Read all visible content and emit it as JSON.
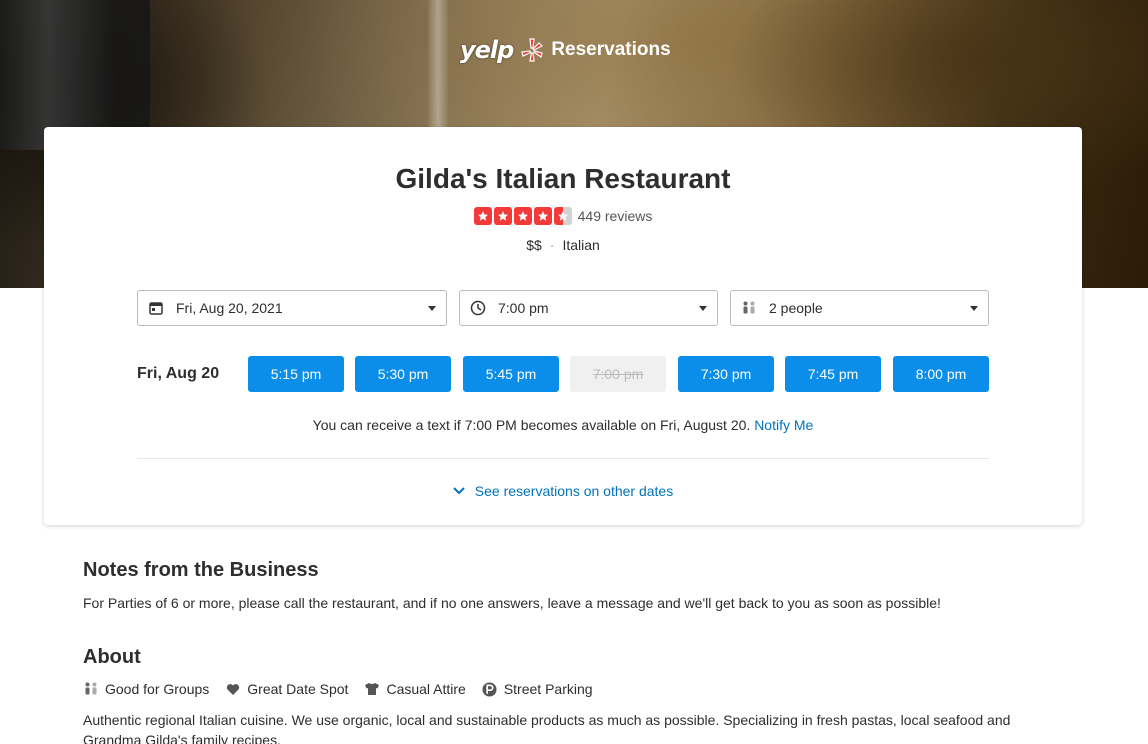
{
  "header": {
    "logo_word": "yelp",
    "title": "Reservations"
  },
  "business": {
    "name": "Gilda's Italian Restaurant",
    "rating": 4.5,
    "reviews": "449 reviews",
    "price": "$$",
    "separator": "·",
    "category": "Italian"
  },
  "search": {
    "date": "Fri, Aug 20, 2021",
    "time": "7:00 pm",
    "party": "2 people"
  },
  "availability": {
    "day_label": "Fri, Aug 20",
    "slots": [
      {
        "label": "5:15 pm",
        "available": true
      },
      {
        "label": "5:30 pm",
        "available": true
      },
      {
        "label": "5:45 pm",
        "available": true
      },
      {
        "label": "7:00 pm",
        "available": false
      },
      {
        "label": "7:30 pm",
        "available": true
      },
      {
        "label": "7:45 pm",
        "available": true
      },
      {
        "label": "8:00 pm",
        "available": true
      }
    ],
    "notify_text": "You can receive a text if 7:00 PM becomes available on Fri, August 20.",
    "notify_link": "Notify Me",
    "other_dates": "See reservations on other dates"
  },
  "notes": {
    "title": "Notes from the Business",
    "text": "For Parties of 6 or more, please call the restaurant, and if no one answers, leave a message and we'll get back to you as soon as possible!"
  },
  "about": {
    "title": "About",
    "amenities": [
      {
        "label": "Good for Groups",
        "icon": "people-icon"
      },
      {
        "label": "Great Date Spot",
        "icon": "heart-icon"
      },
      {
        "label": "Casual Attire",
        "icon": "shirt-icon"
      },
      {
        "label": "Street Parking",
        "icon": "parking-icon"
      }
    ],
    "description": "Authentic regional Italian cuisine. We use organic, local and sustainable products as much as possible. Specializing in fresh pastas, local seafood and Grandma Gilda's family recipes."
  },
  "colors": {
    "brand_red": "#f43939",
    "slot_blue": "#0a8ee9",
    "link_blue": "#0073bb"
  }
}
